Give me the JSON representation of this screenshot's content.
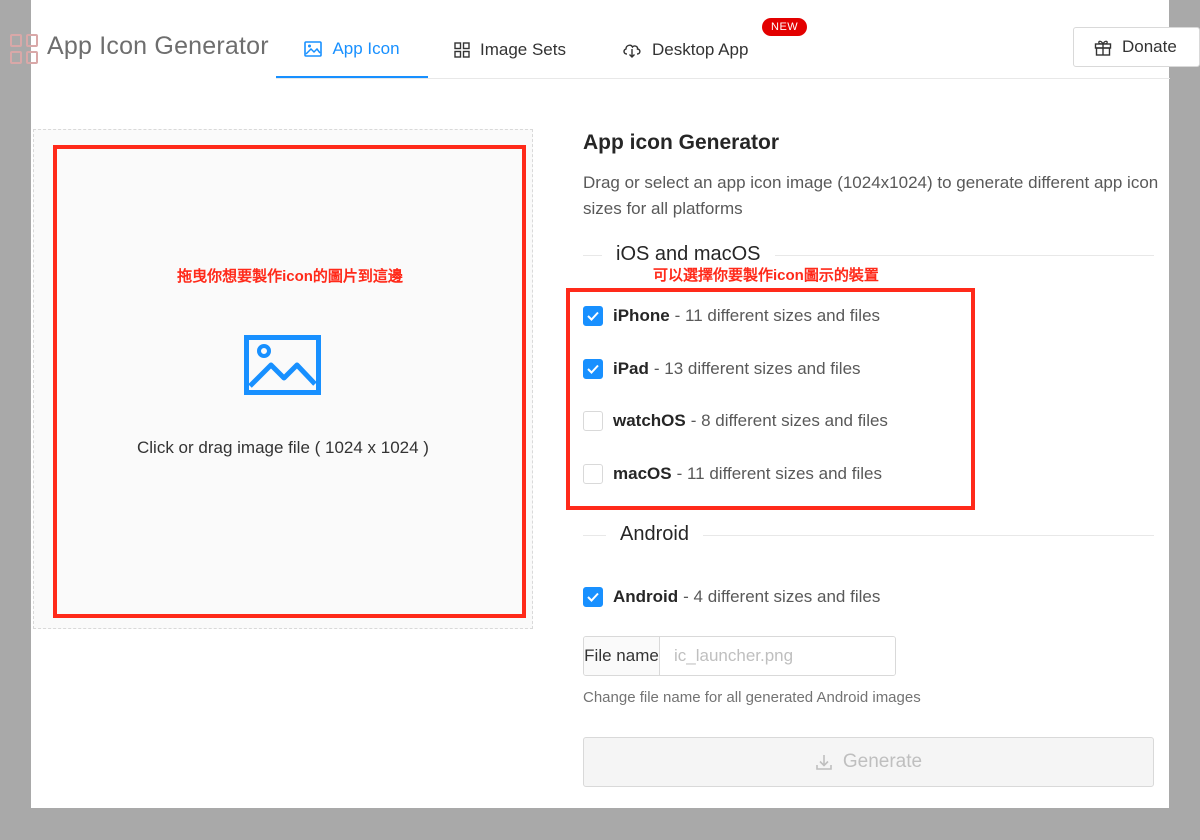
{
  "header": {
    "app_title": "App Icon Generator",
    "tabs": [
      {
        "label": "App Icon",
        "icon": "image-icon",
        "active": true
      },
      {
        "label": "Image Sets",
        "icon": "grid-icon",
        "active": false
      },
      {
        "label": "Desktop App",
        "icon": "cloud-download-icon",
        "active": false
      }
    ],
    "new_badge": "NEW",
    "donate_label": "Donate"
  },
  "dropzone": {
    "annotation": "拖曳你想要製作icon的圖片到這邊",
    "hint": "Click or drag image file ( 1024 x 1024 )"
  },
  "generator": {
    "title": "App icon Generator",
    "description": "Drag or select an app icon image (1024x1024) to generate different app icon sizes for all platforms",
    "ios_section": "iOS and macOS",
    "ios_annotation": "可以選擇你要製作icon圖示的裝置",
    "ios_options": [
      {
        "name": "iPhone",
        "detail": "- 11 different sizes and files",
        "checked": true
      },
      {
        "name": "iPad",
        "detail": "- 13 different sizes and files",
        "checked": true
      },
      {
        "name": "watchOS",
        "detail": "- 8 different sizes and files",
        "checked": false
      },
      {
        "name": "macOS",
        "detail": "- 11 different sizes and files",
        "checked": false
      }
    ],
    "android_section": "Android",
    "android_option": {
      "name": "Android",
      "detail": "- 4 different sizes and files",
      "checked": true
    },
    "file_name_label": "File name",
    "file_name_placeholder": "ic_launcher.png",
    "file_name_help": "Change file name for all generated Android images",
    "generate_label": "Generate"
  },
  "colors": {
    "accent": "#1890ff",
    "annotation_red": "#ff2a1a",
    "badge_red": "#e30000"
  }
}
